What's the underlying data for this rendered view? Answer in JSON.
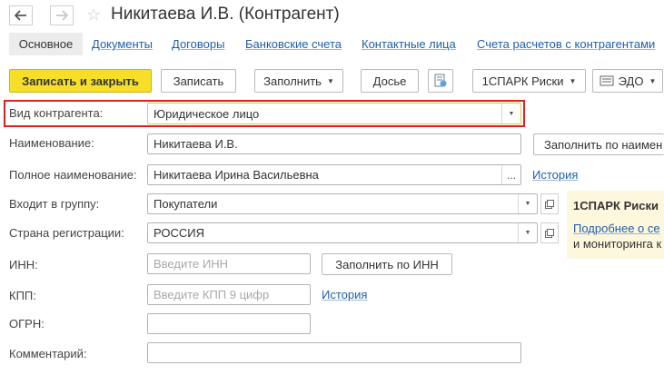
{
  "header": {
    "back_icon": "arrow-left-icon",
    "forward_icon": "arrow-right-icon",
    "favorite_icon": "star-icon",
    "title": "Никитаева И.В. (Контрагент)"
  },
  "tabs": [
    {
      "label": "Основное",
      "active": true
    },
    {
      "label": "Документы"
    },
    {
      "label": "Договоры"
    },
    {
      "label": "Банковские счета"
    },
    {
      "label": "Контактные лица"
    },
    {
      "label": "Счета расчетов с контрагентами"
    }
  ],
  "toolbar": {
    "save_close": "Записать и закрыть",
    "save": "Записать",
    "fill": "Заполнить",
    "dossier": "Досье",
    "report_icon": "report-icon",
    "spark": "1СПАРК Риски",
    "edo_icon": "edo-icon",
    "edo": "ЭДО"
  },
  "form": {
    "kind_label": "Вид контрагента:",
    "kind_value": "Юридическое лицо",
    "name_label": "Наименование:",
    "name_value": "Никитаева И.В.",
    "fill_by_name": "Заполнить по наимен",
    "full_name_label": "Полное наименование:",
    "full_name_value": "Никитаева Ирина Васильевна",
    "ellipsis": "...",
    "history": "История",
    "group_label": "Входит в группу:",
    "group_value": "Покупатели",
    "country_label": "Страна регистрации:",
    "country_value": "РОССИЯ",
    "inn_label": "ИНН:",
    "inn_placeholder": "Введите ИНН",
    "fill_by_inn": "Заполнить по ИНН",
    "kpp_label": "КПП:",
    "kpp_placeholder": "Введите КПП 9 цифр",
    "kpp_history": "История",
    "ogrn_label": "ОГРН:",
    "comment_label": "Комментарий:"
  },
  "side_panel": {
    "title": "1СПАРК Риски",
    "link": "Подробнее о се",
    "text": "и мониторинга к"
  },
  "colors": {
    "accent_yellow": "#f7df27",
    "highlight_red": "#e02020",
    "link_blue": "#1f5fa8",
    "panel_bg": "#fdf7dd"
  }
}
